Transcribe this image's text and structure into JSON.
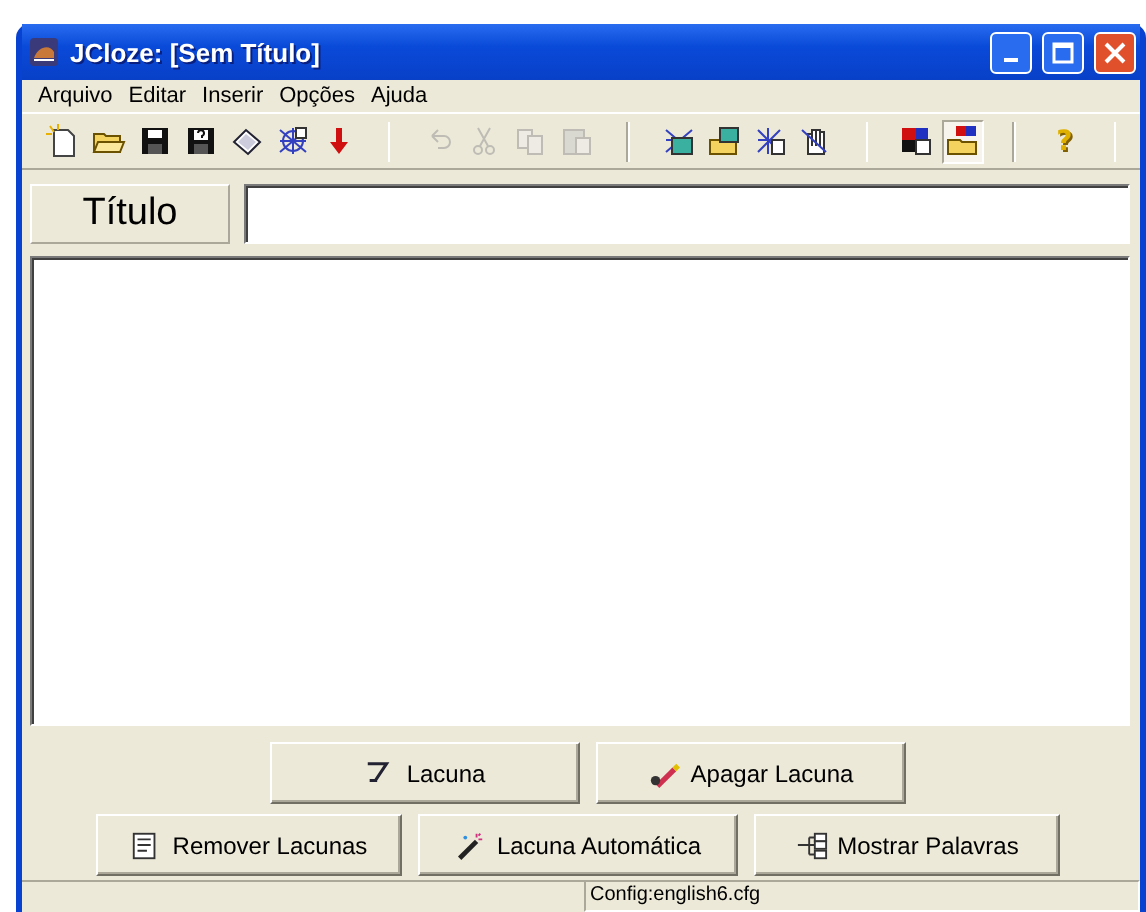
{
  "window": {
    "title": "JCloze: [Sem Título]"
  },
  "menu": [
    "Arquivo",
    "Editar",
    "Inserir",
    "Opções",
    "Ajuda"
  ],
  "toolbar": [
    [
      {
        "kind": "new",
        "disabled": false,
        "pressed": false
      },
      {
        "kind": "open",
        "disabled": false,
        "pressed": false
      },
      {
        "kind": "save",
        "disabled": false,
        "pressed": false
      },
      {
        "kind": "saveas",
        "disabled": false,
        "pressed": false
      },
      {
        "kind": "eraser",
        "disabled": false,
        "pressed": false
      },
      {
        "kind": "web",
        "disabled": false,
        "pressed": false
      },
      {
        "kind": "arrow",
        "disabled": false,
        "pressed": false
      }
    ],
    [
      {
        "kind": "undo",
        "disabled": true,
        "pressed": false
      },
      {
        "kind": "cut",
        "disabled": true,
        "pressed": false
      },
      {
        "kind": "copy",
        "disabled": true,
        "pressed": false
      },
      {
        "kind": "paste",
        "disabled": true,
        "pressed": false
      }
    ],
    [
      {
        "kind": "webimage",
        "disabled": false,
        "pressed": false
      },
      {
        "kind": "folderimage",
        "disabled": false,
        "pressed": false
      },
      {
        "kind": "webpage",
        "disabled": false,
        "pressed": false
      },
      {
        "kind": "hand",
        "disabled": false,
        "pressed": false
      }
    ],
    [
      {
        "kind": "colors",
        "disabled": false,
        "pressed": false
      },
      {
        "kind": "colorfolder",
        "disabled": false,
        "pressed": true
      }
    ],
    [
      {
        "kind": "help",
        "disabled": false,
        "pressed": false,
        "glyph": "?"
      }
    ]
  ],
  "title_row": {
    "label": "Título"
  },
  "buttons": [
    [
      {
        "kind": "gap",
        "label": "Lacuna"
      },
      {
        "kind": "erase",
        "label": "Apagar Lacuna"
      }
    ],
    [
      {
        "kind": "remove",
        "label": "Remover Lacunas"
      },
      {
        "kind": "auto",
        "label": "Lacuna Automática"
      },
      {
        "kind": "show",
        "label": "Mostrar Palavras"
      }
    ]
  ],
  "status_bar": {
    "config": "Config:english6.cfg"
  }
}
